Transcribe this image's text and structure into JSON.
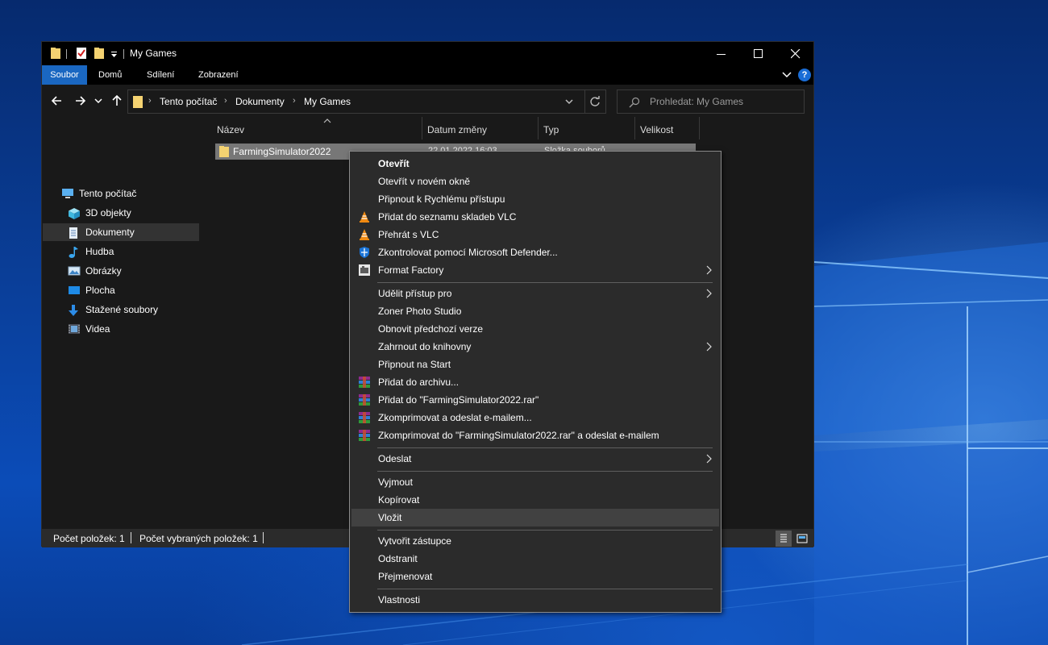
{
  "window": {
    "title": "My Games",
    "controls": [
      "minimize",
      "maximize",
      "close"
    ]
  },
  "ribbon": {
    "tabs": [
      "Soubor",
      "Domů",
      "Sdílení",
      "Zobrazení"
    ],
    "help": "?"
  },
  "navigation": {
    "breadcrumb": [
      "Tento počítač",
      "Dokumenty",
      "My Games"
    ],
    "search_placeholder": "Prohledat: My Games"
  },
  "sidebar": {
    "items": [
      {
        "label": "Tento počítač",
        "icon": "computer-icon"
      },
      {
        "label": "3D objekty",
        "icon": "cube-icon"
      },
      {
        "label": "Dokumenty",
        "icon": "document-icon",
        "selected": true
      },
      {
        "label": "Hudba",
        "icon": "music-note-icon"
      },
      {
        "label": "Obrázky",
        "icon": "picture-icon"
      },
      {
        "label": "Plocha",
        "icon": "desktop-icon"
      },
      {
        "label": "Stažené soubory",
        "icon": "download-arrow-icon"
      },
      {
        "label": "Videa",
        "icon": "film-icon"
      }
    ]
  },
  "file_list": {
    "columns": [
      "Název",
      "Datum změny",
      "Typ",
      "Velikost"
    ],
    "rows": [
      {
        "name": "FarmingSimulator2022",
        "date": "22.01.2022 16:03",
        "type": "Složka souborů",
        "size": ""
      }
    ]
  },
  "status": {
    "count": "Počet položek: 1",
    "selected": "Počet vybraných položek: 1"
  },
  "context_menu": {
    "groups": [
      [
        {
          "label": "Otevřít",
          "bold": true
        },
        {
          "label": "Otevřít v novém okně"
        },
        {
          "label": "Připnout k Rychlému přístupu"
        },
        {
          "label": "Přidat do seznamu skladeb VLC",
          "icon": "vlc-cone-icon"
        },
        {
          "label": "Přehrát s VLC",
          "icon": "vlc-cone-icon"
        },
        {
          "label": "Zkontrolovat pomocí Microsoft Defender...",
          "icon": "defender-shield-icon"
        },
        {
          "label": "Format Factory",
          "icon": "format-factory-icon",
          "submenu": true
        }
      ],
      [
        {
          "label": "Udělit přístup pro",
          "submenu": true
        },
        {
          "label": "Zoner Photo Studio"
        },
        {
          "label": "Obnovit předchozí verze"
        },
        {
          "label": "Zahrnout do knihovny",
          "submenu": true
        },
        {
          "label": "Připnout na Start"
        },
        {
          "label": "Přidat do archivu...",
          "icon": "winrar-icon"
        },
        {
          "label": "Přidat do \"FarmingSimulator2022.rar\"",
          "icon": "winrar-icon"
        },
        {
          "label": "Zkomprimovat a odeslat e-mailem...",
          "icon": "winrar-icon"
        },
        {
          "label": "Zkomprimovat do \"FarmingSimulator2022.rar\" a odeslat e-mailem",
          "icon": "winrar-icon"
        }
      ],
      [
        {
          "label": "Odeslat",
          "submenu": true
        }
      ],
      [
        {
          "label": "Vyjmout"
        },
        {
          "label": "Kopírovat"
        },
        {
          "label": "Vložit",
          "hovered": true
        }
      ],
      [
        {
          "label": "Vytvořit zástupce"
        },
        {
          "label": "Odstranit"
        },
        {
          "label": "Přejmenovat"
        }
      ],
      [
        {
          "label": "Vlastnosti"
        }
      ]
    ]
  },
  "colors": {
    "accent": "#1a67c1",
    "window_bg": "#191919",
    "menu_bg": "#2b2b2b",
    "selected_row": "#777777",
    "desktop": "#0a3f9a"
  }
}
